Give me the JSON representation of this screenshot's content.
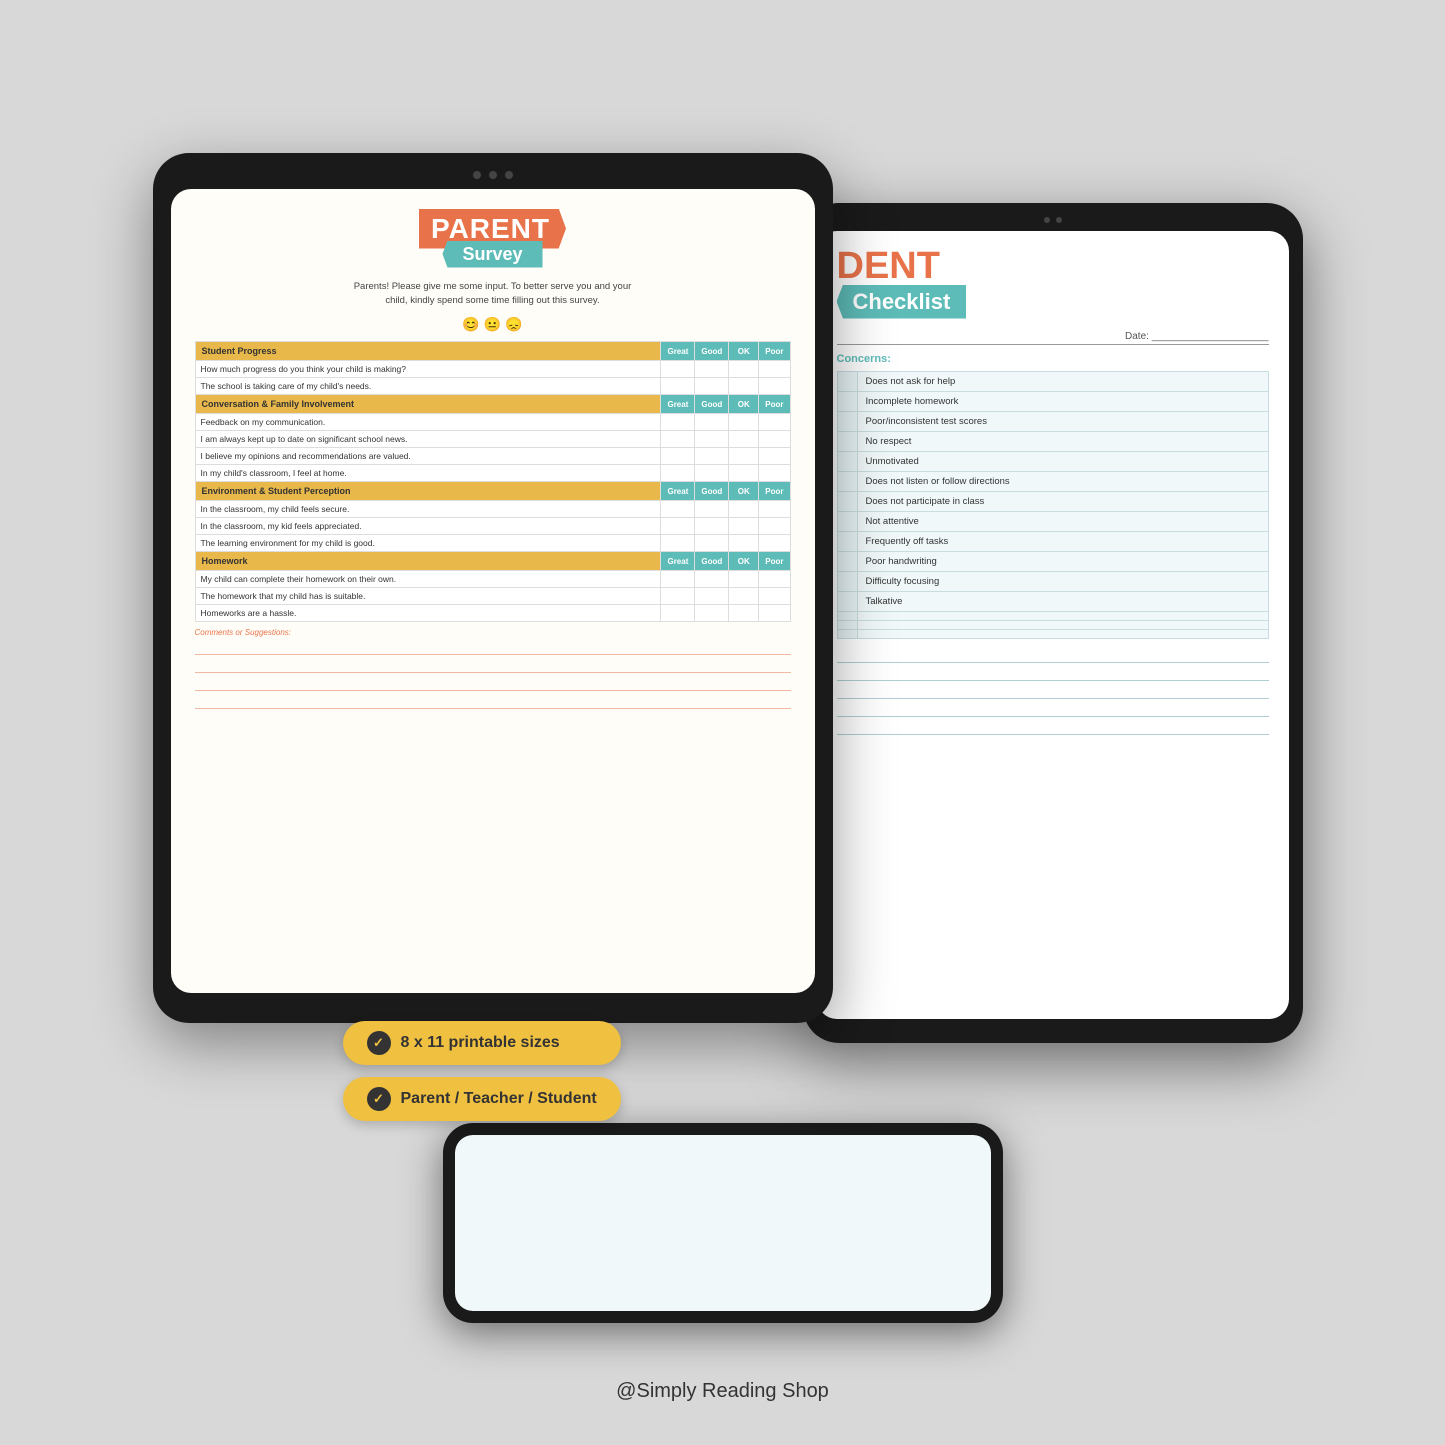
{
  "page": {
    "background_color": "#d8d8d8",
    "footer_text": "@Simply Reading Shop"
  },
  "tablet_left": {
    "survey": {
      "parent_label": "PARENT",
      "survey_label": "Survey",
      "subtitle_line1": "Parents! Please give me some input. To better serve you and your",
      "subtitle_line2": "child, kindly spend some time filling out this survey.",
      "emojis": [
        "😊",
        "😐",
        "😞"
      ],
      "sections": [
        {
          "title": "Student Progress",
          "col_headers": [
            "Great",
            "Good",
            "OK",
            "Poor"
          ],
          "questions": [
            "How much progress do you think your child is making?",
            "The school is taking care of my child's needs."
          ]
        },
        {
          "title": "Conversation & Family Involvement",
          "col_headers": [
            "Great",
            "Good",
            "OK",
            "Poor"
          ],
          "questions": [
            "Feedback on my communication.",
            "I am always kept up to date on significant school news.",
            "I believe my opinions and recommendations are valued.",
            "In my child's classroom, I feel at home."
          ]
        },
        {
          "title": "Environment & Student Perception",
          "col_headers": [
            "Great",
            "Good",
            "OK",
            "Poor"
          ],
          "questions": [
            "In the classroom, my child feels secure.",
            "In the classroom, my kid feels appreciated.",
            "The learning environment for my child is good."
          ]
        },
        {
          "title": "Homework",
          "col_headers": [
            "Great",
            "Good",
            "OK",
            "Poor"
          ],
          "questions": [
            "My child can complete their homework on their own.",
            "The homework that my child has is suitable.",
            "Homeworks are a hassle."
          ]
        }
      ],
      "comments_label": "Comments or Suggestions:",
      "comment_lines": 4
    }
  },
  "tablet_right": {
    "checklist": {
      "student_partial": "DENT",
      "checklist_label": "Checklist",
      "date_label": "Date:",
      "concerns_label": "Concerns:",
      "items": [
        "Does not ask for help",
        "Incomplete homework",
        "Poor/inconsistent test scores",
        "No respect",
        "Unmotivated",
        "Does not listen or follow directions",
        "Does not participate in class",
        "Not attentive",
        "Frequently off tasks",
        "Poor handwriting",
        "Difficulty focusing",
        "Talkative"
      ],
      "extra_lines": 5
    }
  },
  "badges": [
    {
      "icon": "✓",
      "text": "8 x 11 printable sizes"
    },
    {
      "icon": "✓",
      "text": "Parent / Teacher / Student"
    }
  ]
}
